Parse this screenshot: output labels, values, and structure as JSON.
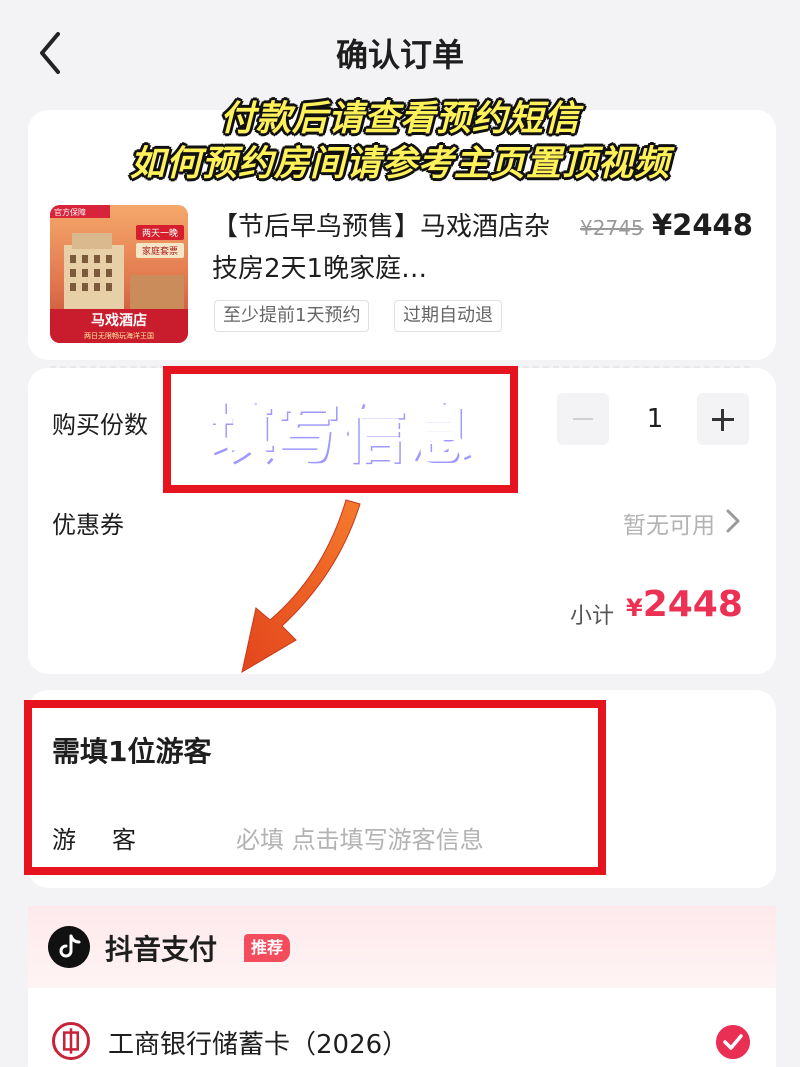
{
  "header": {
    "title": "确认订单"
  },
  "overlay": {
    "caption_line1": "付款后请查看预约短信",
    "caption_line2": "如何预约房间请参考主页置顶视频",
    "fill_info_text": "填写信息"
  },
  "product": {
    "badge": "官方保障",
    "image_text": {
      "ribbon1": "两天一晚",
      "ribbon2": "家庭套票",
      "hotel_name": "马戏酒店",
      "subtitle": "两日无限畅玩海洋王国"
    },
    "title": "【节后早鸟预售】马戏酒店杂技房2天1晚家庭…",
    "original_price": "¥2745",
    "price": "¥2448",
    "tags": [
      "至少提前1天预约",
      "过期自动退"
    ]
  },
  "purchase": {
    "quantity_label": "购买份数",
    "quantity": "1",
    "coupon_label": "优惠券",
    "coupon_value": "暂无可用",
    "subtotal_label": "小计",
    "subtotal_currency": "¥",
    "subtotal_value": "2448"
  },
  "tourist": {
    "title": "需填1位游客",
    "field_label": "游客",
    "placeholder": "必填 点击填写游客信息"
  },
  "payment": {
    "title": "抖音支付",
    "badge": "推荐",
    "bank_name": "工商银行储蓄卡（2026）"
  },
  "colors": {
    "accent": "#ec3155",
    "highlight_border": "#e5141e",
    "caption": "#fff15a"
  }
}
